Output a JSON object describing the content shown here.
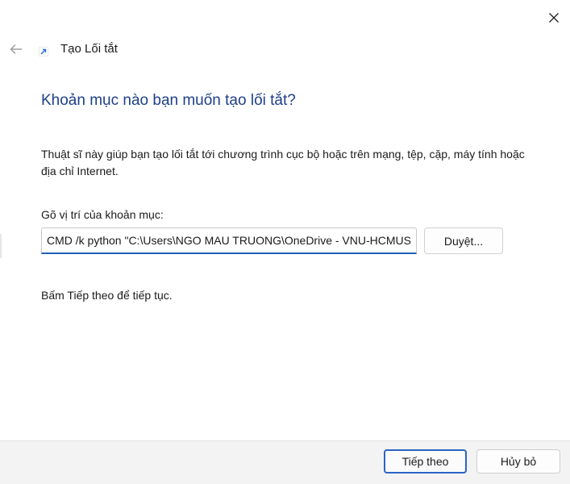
{
  "window": {
    "title": "Tạo Lối tắt"
  },
  "wizard": {
    "heading": "Khoản mục nào bạn muốn tạo lối tắt?",
    "description": "Thuật sĩ này giúp bạn tạo lối tắt tới chương trình cục bộ hoặc trên mạng, tệp, cặp, máy tính hoặc địa chỉ Internet.",
    "location_label": "Gõ vị trí của khoản mục:",
    "location_value": "CMD /k python \"C:\\Users\\NGO MAU TRUONG\\OneDrive - VNU-HCMUS",
    "browse_label": "Duyệt...",
    "hint": "Bấm Tiếp theo để tiếp tục."
  },
  "footer": {
    "next_label": "Tiếp theo",
    "cancel_label": "Hủy bỏ"
  },
  "icons": {
    "close": "close-icon",
    "back": "back-arrow-icon",
    "shortcut": "shortcut-arrow-icon"
  },
  "colors": {
    "heading": "#1e3f8a",
    "accent": "#2b64c4",
    "footer_bg": "#f3f3f3"
  }
}
